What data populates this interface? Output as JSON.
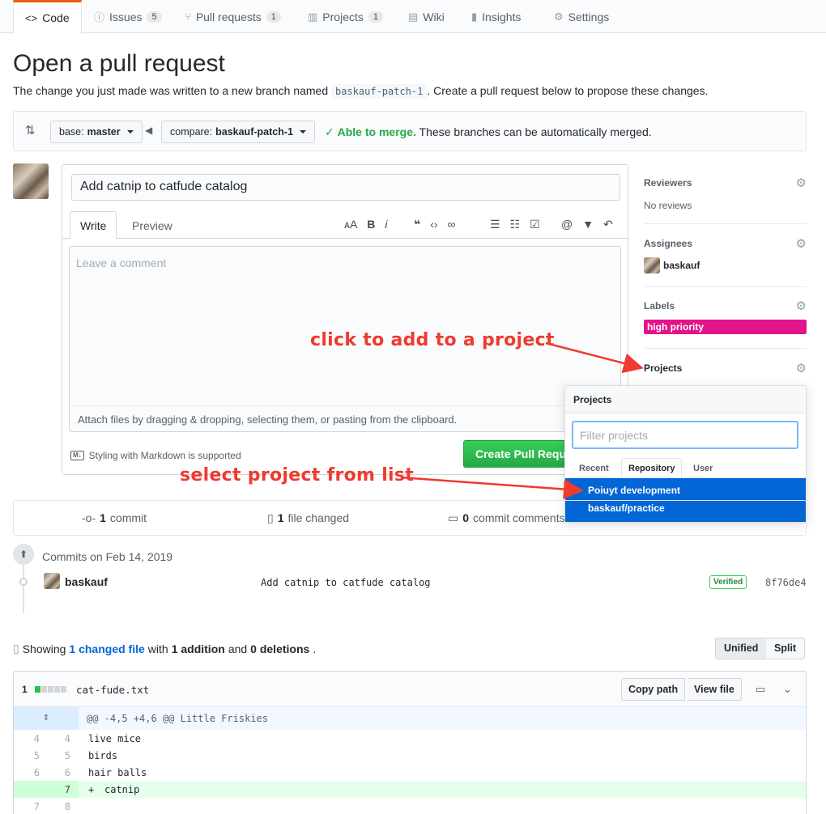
{
  "tabs": [
    {
      "label": "Code",
      "icon": "code-icon"
    },
    {
      "label": "Issues",
      "count": "5",
      "icon": "issue-icon"
    },
    {
      "label": "Pull requests",
      "count": "1",
      "icon": "pull-request-icon"
    },
    {
      "label": "Projects",
      "count": "1",
      "icon": "project-icon"
    },
    {
      "label": "Wiki",
      "icon": "book-icon"
    },
    {
      "label": "Insights",
      "icon": "graph-icon"
    },
    {
      "label": "Settings",
      "icon": "gear-icon"
    }
  ],
  "page": {
    "title": "Open a pull request",
    "subtitle_pre": "The change you just made was written to a new branch named",
    "branch": "baskauf-patch-1",
    "subtitle_post": ". Create a pull request below to propose these changes."
  },
  "compare": {
    "base_label": "base:",
    "base_value": "master",
    "compare_label": "compare:",
    "compare_value": "baskauf-patch-1",
    "merge_ok": "Able to merge.",
    "merge_text": "These branches can be automatically merged."
  },
  "comment": {
    "title_value": "Add catnip to catfude catalog",
    "tab_write": "Write",
    "tab_preview": "Preview",
    "placeholder": "Leave a comment",
    "attach": "Attach files by dragging & dropping, selecting them, or pasting from the clipboard.",
    "markdown": "Styling with Markdown is supported",
    "create_button": "Create Pull Request"
  },
  "sidebar": {
    "reviewers_title": "Reviewers",
    "reviewers_value": "No reviews",
    "assignees_title": "Assignees",
    "assignee": "baskauf",
    "labels_title": "Labels",
    "label": "high priority",
    "label_color": "#e3138a",
    "projects_title": "Projects"
  },
  "projects_dropdown": {
    "header": "Projects",
    "filter_placeholder": "Filter projects",
    "tabs": [
      "Recent",
      "Repository",
      "User"
    ],
    "selected_name": "Poiuyt development",
    "selected_repo": "baskauf/practice"
  },
  "annotations": {
    "add_project": "click to add to a project",
    "select_project": "select project from list",
    "color": "#ee3a2f"
  },
  "stats": {
    "commits_count": "1",
    "commits_label": "commit",
    "files_count": "1",
    "files_label": "file changed",
    "comments_count": "0",
    "comments_label": "commit comments"
  },
  "commits": {
    "date_label": "Commits on Feb 14, 2019",
    "author": "baskauf",
    "message": "Add catnip to catfude catalog",
    "verified": "Verified",
    "sha": "8f76de4"
  },
  "summary": {
    "showing": "Showing",
    "changed_link": "1 changed file",
    "with": "with",
    "additions": "1 addition",
    "and": "and",
    "deletions": "0 deletions",
    "unified": "Unified",
    "split": "Split"
  },
  "file": {
    "count": "1",
    "name": "cat-fude.txt",
    "copy_path": "Copy path",
    "view_file": "View file",
    "hunk": "@@ -4,5 +4,6 @@ Little Friskies",
    "lines": [
      {
        "old": "4",
        "new": "4",
        "sign": " ",
        "text": "live mice",
        "added": false
      },
      {
        "old": "5",
        "new": "5",
        "sign": " ",
        "text": "birds",
        "added": false
      },
      {
        "old": "6",
        "new": "6",
        "sign": " ",
        "text": "hair balls",
        "added": false
      },
      {
        "old": "",
        "new": "7",
        "sign": "+",
        "text": "catnip",
        "added": true
      },
      {
        "old": "7",
        "new": "8",
        "sign": " ",
        "text": "",
        "added": false
      }
    ]
  }
}
